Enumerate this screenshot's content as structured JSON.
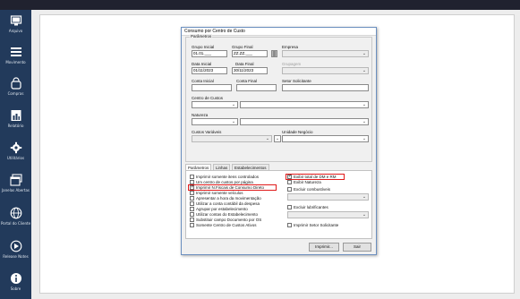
{
  "sidebar": {
    "items": [
      {
        "label": "Arquivo",
        "icon": "monitor-icon"
      },
      {
        "label": "Movimento",
        "icon": "menu-lines-icon"
      },
      {
        "label": "Compras",
        "icon": "shopping-bag-icon"
      },
      {
        "label": "Relatório",
        "icon": "report-chart-icon"
      },
      {
        "label": "Utilitários",
        "icon": "gear-icon"
      },
      {
        "label": "Janelas Abertas",
        "icon": "windows-icon"
      },
      {
        "label": "Portal do Cliente",
        "icon": "globe-icon"
      },
      {
        "label": "Release Notes",
        "icon": "release-notes-icon"
      },
      {
        "label": "Sobre",
        "icon": "info-icon"
      }
    ]
  },
  "dialog": {
    "title": "Consumo por Centro de Custo",
    "group_title": "Parâmetros",
    "fields": {
      "grupo_inicial_label": "Grupo Inicial",
      "grupo_inicial_value": "01.01.___",
      "grupo_final_label": "Grupo Final",
      "grupo_final_value": "ZZ.ZZ.___",
      "empresa_label": "Empresa",
      "data_inicial_label": "Data Inicial",
      "data_inicial_value": "01/11/2023",
      "data_final_label": "Data Final",
      "data_final_value": "30/11/2023",
      "grupo_label": "Grupagem",
      "conta_inicial_label": "Conta Inicial",
      "conta_final_label": "Conta Final",
      "setor_solicitante_label": "Setor Solicitante",
      "centro_custos_label": "Centro de Custos",
      "natureza_label": "Natureza",
      "custos_variaveis_label": "Custos Variáveis",
      "unidade_negocio_label": "Unidade Negócio"
    },
    "tabs": [
      "Parâmetros",
      "Linhas",
      "Estabelecimentos"
    ],
    "checks_left": [
      {
        "label": "Imprimir somente itens controlados",
        "checked": false
      },
      {
        "label": "Um centro de custos por página",
        "checked": false
      },
      {
        "label": "Imprimir N.Fiscais de Consumo Direto",
        "checked": true
      },
      {
        "label": "Imprimir somente veículos",
        "checked": false
      },
      {
        "label": "Apresentar a hora da movimentação",
        "checked": false
      },
      {
        "label": "Utilizar a conta contábil da despesa",
        "checked": false
      },
      {
        "label": "Agrupar por estabelecimento",
        "checked": false
      },
      {
        "label": "Utilizar contas do Estabelecimento",
        "checked": false
      },
      {
        "label": "Substituir campo Documento por OS",
        "checked": false
      },
      {
        "label": "Somente Centro de Custos Ativos",
        "checked": false
      }
    ],
    "checks_right": [
      {
        "label": "Exibir total de DM e RM",
        "checked": true
      },
      {
        "label": "Exibir Natureza",
        "checked": false
      },
      {
        "label": "Excluir combustíveis",
        "checked": false
      },
      {
        "label": "Excluir lubrificantes",
        "checked": false
      },
      {
        "label": "Imprimir Setor Solicitante",
        "checked": false
      }
    ],
    "buttons": {
      "print": "Imprimir...",
      "exit": "Sair"
    }
  }
}
